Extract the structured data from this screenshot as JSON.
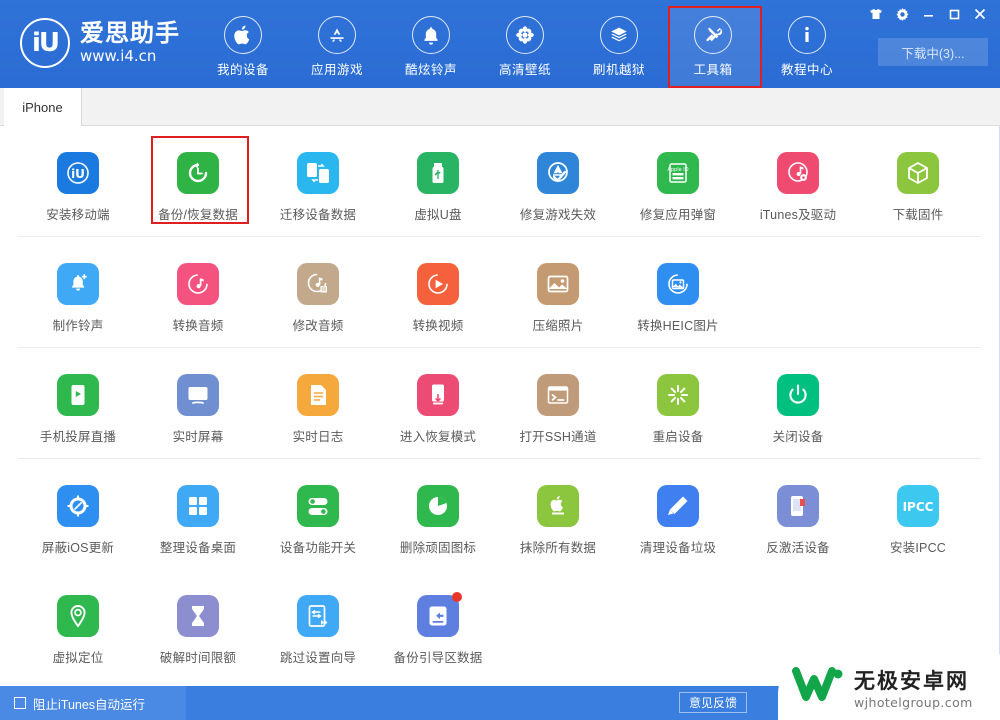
{
  "header": {
    "logo": {
      "mark": "iU",
      "title": "爱思助手",
      "url": "www.i4.cn"
    },
    "nav": [
      {
        "label": "我的设备",
        "icon": "apple-icon"
      },
      {
        "label": "应用游戏",
        "icon": "appstore-icon"
      },
      {
        "label": "酷炫铃声",
        "icon": "bell-icon"
      },
      {
        "label": "高清壁纸",
        "icon": "flower-icon"
      },
      {
        "label": "刷机越狱",
        "icon": "box-icon"
      },
      {
        "label": "工具箱",
        "icon": "tools-icon",
        "selected": true
      },
      {
        "label": "教程中心",
        "icon": "info-icon"
      }
    ],
    "window_controls": [
      {
        "name": "skin-icon",
        "label": "皮肤"
      },
      {
        "name": "gear-icon",
        "label": "设置"
      },
      {
        "name": "minimize-icon",
        "label": "最小化"
      },
      {
        "name": "maximize-icon",
        "label": "最大化"
      },
      {
        "name": "close-icon",
        "label": "关闭"
      }
    ],
    "download_button": "下载中(3)..."
  },
  "tabs": [
    {
      "label": "iPhone",
      "active": true
    }
  ],
  "tool_sections": [
    {
      "tools": [
        {
          "label": "安装移动端",
          "icon": "i4-app-icon",
          "color": "#1a7ae0"
        },
        {
          "label": "备份/恢复数据",
          "icon": "backup-restore-icon",
          "color": "#2fb344",
          "highlight": true
        },
        {
          "label": "迁移设备数据",
          "icon": "migrate-device-icon",
          "color": "#2ab7f0"
        },
        {
          "label": "虚拟U盘",
          "icon": "usb-drive-icon",
          "color": "#28b463"
        },
        {
          "label": "修复游戏失效",
          "icon": "fix-game-icon",
          "color": "#2f86d8"
        },
        {
          "label": "修复应用弹窗",
          "icon": "apple-id-icon",
          "color": "#2eb84d"
        },
        {
          "label": "iTunes及驱动",
          "icon": "itunes-driver-icon",
          "color": "#ef4a70"
        },
        {
          "label": "下载固件",
          "icon": "firmware-icon",
          "color": "#8cc63f"
        }
      ]
    },
    {
      "tools": [
        {
          "label": "制作铃声",
          "icon": "make-ringtone-icon",
          "color": "#3fa9f5"
        },
        {
          "label": "转换音频",
          "icon": "convert-audio-icon",
          "color": "#f4537f"
        },
        {
          "label": "修改音频",
          "icon": "edit-audio-icon",
          "color": "#c3a98c"
        },
        {
          "label": "转换视频",
          "icon": "convert-video-icon",
          "color": "#f4613c"
        },
        {
          "label": "压缩照片",
          "icon": "compress-photo-icon",
          "color": "#c39a72"
        },
        {
          "label": "转换HEIC图片",
          "icon": "convert-heic-icon",
          "color": "#2f8ff0"
        }
      ]
    },
    {
      "tools": [
        {
          "label": "手机投屏直播",
          "icon": "screen-cast-icon",
          "color": "#2eb84d"
        },
        {
          "label": "实时屏幕",
          "icon": "realtime-screen-icon",
          "color": "#6f8fd0"
        },
        {
          "label": "实时日志",
          "icon": "realtime-log-icon",
          "color": "#f5a83c"
        },
        {
          "label": "进入恢复模式",
          "icon": "recovery-mode-icon",
          "color": "#ec4b73"
        },
        {
          "label": "打开SSH通道",
          "icon": "ssh-tunnel-icon",
          "color": "#c09b79"
        },
        {
          "label": "重启设备",
          "icon": "reboot-device-icon",
          "color": "#8cc63f"
        },
        {
          "label": "关闭设备",
          "icon": "shutdown-device-icon",
          "color": "#00c07f"
        }
      ]
    },
    {
      "tools": [
        {
          "label": "屏蔽iOS更新",
          "icon": "block-ios-update-icon",
          "color": "#2f8ff0"
        },
        {
          "label": "整理设备桌面",
          "icon": "organize-desktop-icon",
          "color": "#3fa9f5"
        },
        {
          "label": "设备功能开关",
          "icon": "feature-toggle-icon",
          "color": "#2eb84d"
        },
        {
          "label": "删除顽固图标",
          "icon": "remove-icon-icon",
          "color": "#2eb84d"
        },
        {
          "label": "抹除所有数据",
          "icon": "erase-all-data-icon",
          "color": "#8cc63f"
        },
        {
          "label": "清理设备垃圾",
          "icon": "clean-junk-icon",
          "color": "#3f7ff0"
        },
        {
          "label": "反激活设备",
          "icon": "deactivate-device-icon",
          "color": "#7c8fd6"
        },
        {
          "label": "安装IPCC",
          "icon": "install-ipcc-icon",
          "color": "#3cc8ef",
          "text": "IPCC"
        }
      ]
    },
    {
      "tools": [
        {
          "label": "虚拟定位",
          "icon": "virtual-location-icon",
          "color": "#2eb84d"
        },
        {
          "label": "破解时间限额",
          "icon": "crack-screentime-icon",
          "color": "#8d8ed0"
        },
        {
          "label": "跳过设置向导",
          "icon": "skip-setup-icon",
          "color": "#3fa9f5"
        },
        {
          "label": "备份引导区数据",
          "icon": "backup-boot-icon",
          "color": "#5f7fe0",
          "badge": true
        }
      ]
    }
  ],
  "footer": {
    "autorun_checkbox_label": "阻止iTunes自动运行",
    "autorun_checked": false,
    "feedback_button": "意见反馈"
  },
  "watermark": {
    "cn": "无极安卓网",
    "en": "wjhotelgroup.com"
  },
  "colors": {
    "header_blue": "#2b6fd6",
    "highlight_red": "#e02020",
    "footer_blue": "#3a7ee0"
  }
}
